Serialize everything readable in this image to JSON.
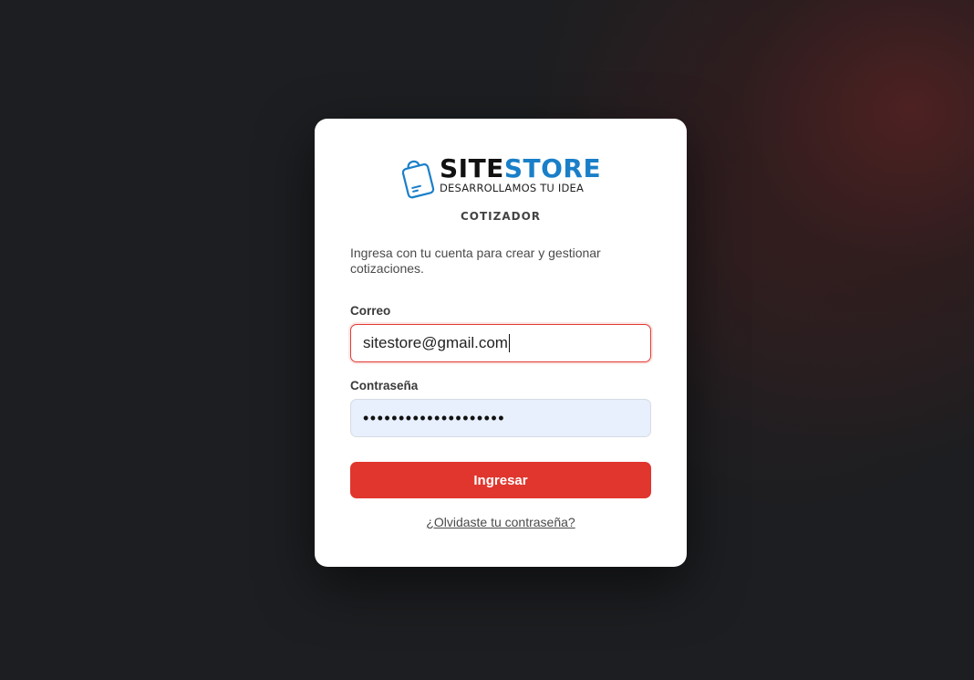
{
  "brand": {
    "name_part1": "SITE",
    "name_part2": "STORE",
    "tagline": "DESARROLLAMOS TU IDEA",
    "logo_icon": "shopping-bag-icon",
    "colors": {
      "dark": "#111111",
      "blue": "#1a7fc8"
    }
  },
  "app": {
    "name": "COTIZADOR"
  },
  "login": {
    "intro": "Ingresa con tu cuenta para crear y gestionar cotizaciones.",
    "email_label": "Correo",
    "email_value": "sitestore@gmail.com",
    "password_label": "Contraseña",
    "password_mask": "••••••••••••••••••••",
    "submit_label": "Ingresar",
    "forgot_label": "¿Olvidaste tu contraseña?"
  },
  "colors": {
    "accent": "#e0362e",
    "autofill_bg": "#e8f0fe",
    "backdrop": "#1d1e21"
  }
}
